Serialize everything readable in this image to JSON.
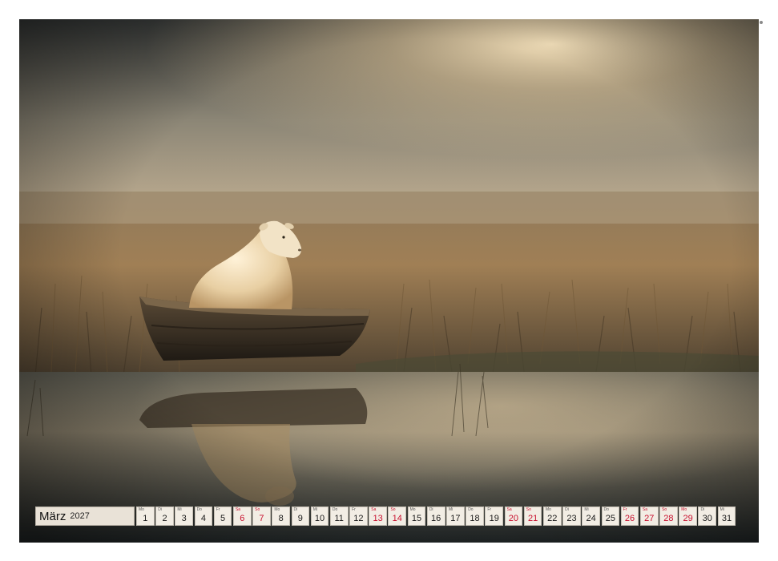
{
  "calendar": {
    "month": "März",
    "year": "2027",
    "days": [
      {
        "wd": "Mo",
        "num": "1",
        "weekend": false
      },
      {
        "wd": "Di",
        "num": "2",
        "weekend": false
      },
      {
        "wd": "Mi",
        "num": "3",
        "weekend": false
      },
      {
        "wd": "Do",
        "num": "4",
        "weekend": false
      },
      {
        "wd": "Fr",
        "num": "5",
        "weekend": false
      },
      {
        "wd": "Sa",
        "num": "6",
        "weekend": true
      },
      {
        "wd": "So",
        "num": "7",
        "weekend": true
      },
      {
        "wd": "Mo",
        "num": "8",
        "weekend": false
      },
      {
        "wd": "Di",
        "num": "9",
        "weekend": false
      },
      {
        "wd": "Mi",
        "num": "10",
        "weekend": false
      },
      {
        "wd": "Do",
        "num": "11",
        "weekend": false
      },
      {
        "wd": "Fr",
        "num": "12",
        "weekend": false
      },
      {
        "wd": "Sa",
        "num": "13",
        "weekend": true
      },
      {
        "wd": "So",
        "num": "14",
        "weekend": true
      },
      {
        "wd": "Mo",
        "num": "15",
        "weekend": false
      },
      {
        "wd": "Di",
        "num": "16",
        "weekend": false
      },
      {
        "wd": "Mi",
        "num": "17",
        "weekend": false
      },
      {
        "wd": "Do",
        "num": "18",
        "weekend": false
      },
      {
        "wd": "Fr",
        "num": "19",
        "weekend": false
      },
      {
        "wd": "Sa",
        "num": "20",
        "weekend": true
      },
      {
        "wd": "So",
        "num": "21",
        "weekend": true
      },
      {
        "wd": "Mo",
        "num": "22",
        "weekend": false
      },
      {
        "wd": "Di",
        "num": "23",
        "weekend": false
      },
      {
        "wd": "Mi",
        "num": "24",
        "weekend": false
      },
      {
        "wd": "Do",
        "num": "25",
        "weekend": false
      },
      {
        "wd": "Fr",
        "num": "26",
        "weekend": true
      },
      {
        "wd": "Sa",
        "num": "27",
        "weekend": true
      },
      {
        "wd": "So",
        "num": "28",
        "weekend": true
      },
      {
        "wd": "Mo",
        "num": "29",
        "weekend": true
      },
      {
        "wd": "Di",
        "num": "30",
        "weekend": false
      },
      {
        "wd": "Mi",
        "num": "31",
        "weekend": false
      }
    ]
  },
  "colors": {
    "weekend_red": "#c8102e",
    "sky_glow": "#f3dcae",
    "grass": "#7a5f3c",
    "water": "#2c3232"
  }
}
